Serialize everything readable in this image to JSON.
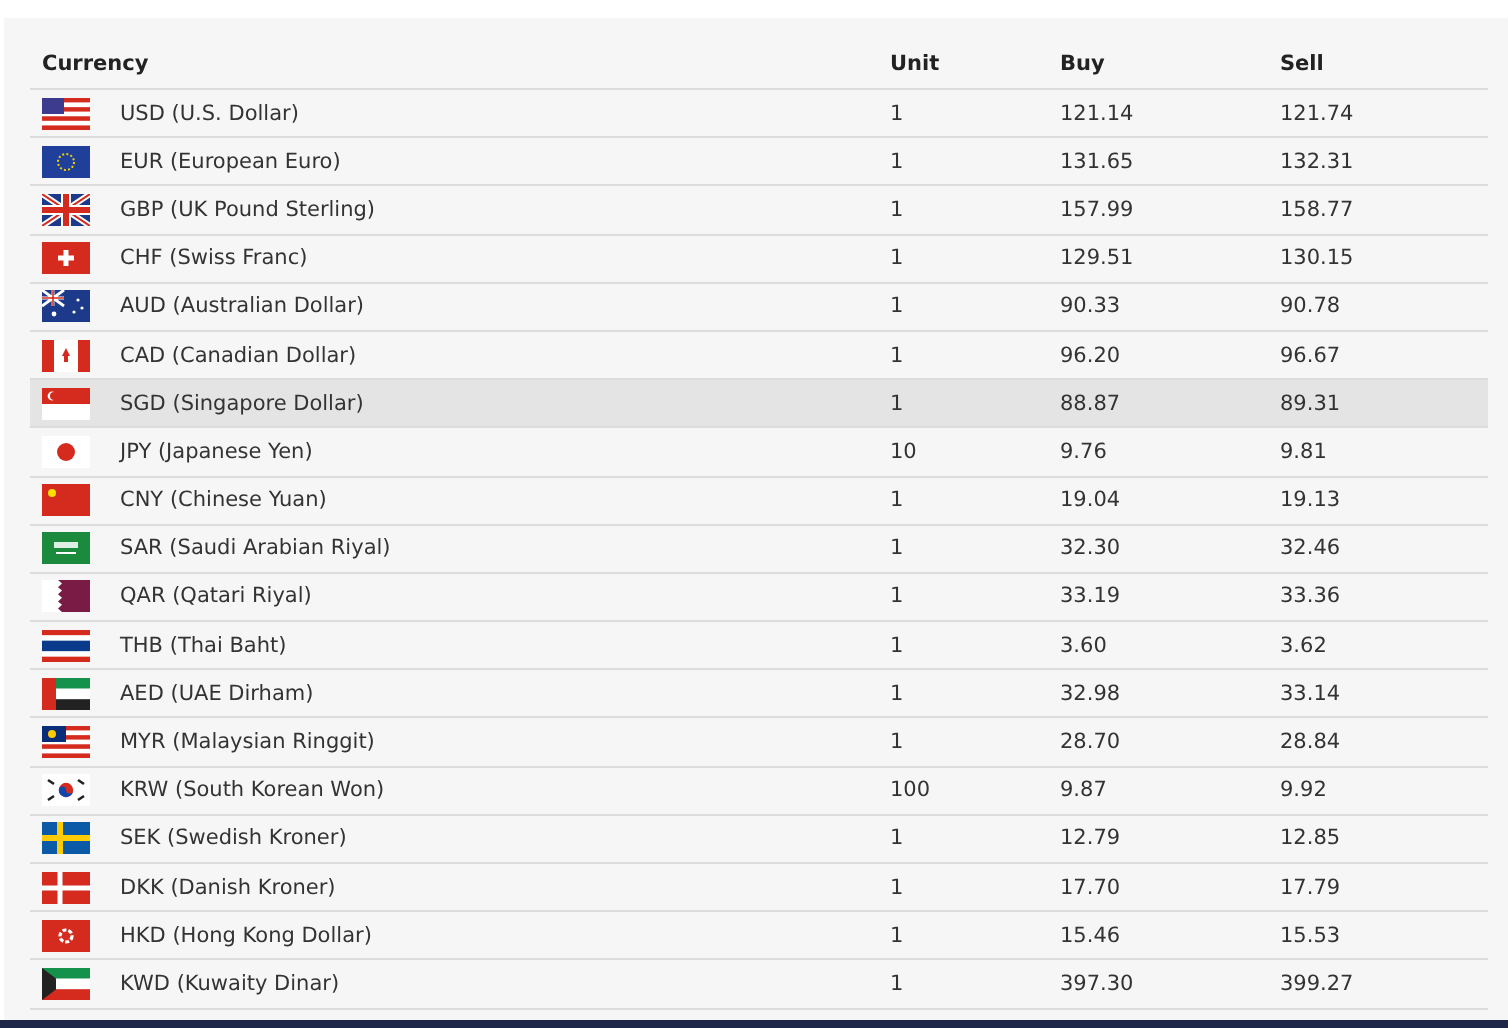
{
  "table": {
    "columns": [
      "Currency",
      "Unit",
      "Buy",
      "Sell"
    ],
    "rows": [
      {
        "currency": "USD (U.S. Dollar)",
        "unit": "1",
        "buy": "121.14",
        "sell": "121.74",
        "selected": false
      },
      {
        "currency": "EUR (European Euro)",
        "unit": "1",
        "buy": "131.65",
        "sell": "132.31",
        "selected": false
      },
      {
        "currency": "GBP (UK Pound Sterling)",
        "unit": "1",
        "buy": "157.99",
        "sell": "158.77",
        "selected": false
      },
      {
        "currency": "CHF (Swiss Franc)",
        "unit": "1",
        "buy": "129.51",
        "sell": "130.15",
        "selected": false
      },
      {
        "currency": "AUD (Australian Dollar)",
        "unit": "1",
        "buy": "90.33",
        "sell": "90.78",
        "selected": false
      },
      {
        "currency": "CAD (Canadian Dollar)",
        "unit": "1",
        "buy": "96.20",
        "sell": "96.67",
        "selected": false
      },
      {
        "currency": "SGD (Singapore Dollar)",
        "unit": "1",
        "buy": "88.87",
        "sell": "89.31",
        "selected": true
      },
      {
        "currency": "JPY (Japanese Yen)",
        "unit": "10",
        "buy": "9.76",
        "sell": "9.81",
        "selected": false
      },
      {
        "currency": "CNY (Chinese Yuan)",
        "unit": "1",
        "buy": "19.04",
        "sell": "19.13",
        "selected": false
      },
      {
        "currency": "SAR (Saudi Arabian Riyal)",
        "unit": "1",
        "buy": "32.30",
        "sell": "32.46",
        "selected": false
      },
      {
        "currency": "QAR (Qatari Riyal)",
        "unit": "1",
        "buy": "33.19",
        "sell": "33.36",
        "selected": false
      },
      {
        "currency": "THB (Thai Baht)",
        "unit": "1",
        "buy": "3.60",
        "sell": "3.62",
        "selected": false
      },
      {
        "currency": "AED (UAE Dirham)",
        "unit": "1",
        "buy": "32.98",
        "sell": "33.14",
        "selected": false
      },
      {
        "currency": "MYR (Malaysian Ringgit)",
        "unit": "1",
        "buy": "28.70",
        "sell": "28.84",
        "selected": false
      },
      {
        "currency": "KRW (South Korean Won)",
        "unit": "100",
        "buy": "9.87",
        "sell": "9.92",
        "selected": false
      },
      {
        "currency": "SEK (Swedish Kroner)",
        "unit": "1",
        "buy": "12.79",
        "sell": "12.85",
        "selected": false
      },
      {
        "currency": "DKK (Danish Kroner)",
        "unit": "1",
        "buy": "17.70",
        "sell": "17.79",
        "selected": false
      },
      {
        "currency": "HKD (Hong Kong Dollar)",
        "unit": "1",
        "buy": "15.46",
        "sell": "15.53",
        "selected": false
      },
      {
        "currency": "KWD (Kuwaity Dinar)",
        "unit": "1",
        "buy": "397.30",
        "sell": "399.27",
        "selected": false
      }
    ]
  }
}
